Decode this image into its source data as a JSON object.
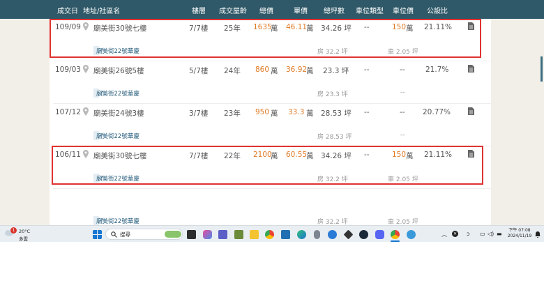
{
  "columns": {
    "date": "成交日",
    "address": "地址/社區名",
    "floor": "樓層",
    "age": "成交屋齡",
    "total": "總價",
    "unit_price": "單價",
    "total_ping": "總坪數",
    "parking_type": "車位類型",
    "parking_price": "車位價",
    "public_ratio": "公設比"
  },
  "rows": [
    {
      "date": "109/09",
      "address": "廟美街30號七樓",
      "floor": "7/7樓",
      "age": "25年",
      "total": "1635",
      "total_unit": "萬",
      "unit_price": "46.11",
      "unit_price_unit": "萬",
      "total_ping": "34.26 坪",
      "parking_type": "--",
      "parking_price": "150",
      "parking_price_unit": "萬",
      "public_ratio": "21.11%",
      "community": "廟美街22號華廈",
      "house_ping": "房 32.2 坪",
      "car_ping": "車 2.05 坪",
      "highlighted": true
    },
    {
      "date": "109/03",
      "address": "廟美街26號5樓",
      "floor": "5/7樓",
      "age": "24年",
      "total": "860",
      "total_unit": "萬",
      "unit_price": "36.92",
      "unit_price_unit": "萬",
      "total_ping": "23.3 坪",
      "parking_type": "--",
      "parking_price": "--",
      "parking_price_unit": "",
      "public_ratio": "21.7%",
      "community": "廟美街22號華廈",
      "house_ping": "房 23.3 坪",
      "car_ping": "--",
      "highlighted": false
    },
    {
      "date": "107/12",
      "address": "廟美街24號3樓",
      "floor": "3/7樓",
      "age": "23年",
      "total": "950",
      "total_unit": "萬",
      "unit_price": "33.3",
      "unit_price_unit": "萬",
      "total_ping": "28.53 坪",
      "parking_type": "--",
      "parking_price": "--",
      "parking_price_unit": "",
      "public_ratio": "20.77%",
      "community": "廟美街22號華廈",
      "house_ping": "房 28.53 坪",
      "car_ping": "--",
      "highlighted": false
    },
    {
      "date": "106/11",
      "address": "廟美街30號七樓",
      "floor": "7/7樓",
      "age": "22年",
      "total": "2100",
      "total_unit": "萬",
      "unit_price": "60.55",
      "unit_price_unit": "萬",
      "total_ping": "34.26 坪",
      "parking_type": "--",
      "parking_price": "150",
      "parking_price_unit": "萬",
      "public_ratio": "21.11%",
      "community": "廟美街22號華廈",
      "house_ping": "房 32.2 坪",
      "car_ping": "車 2.05 坪",
      "highlighted": true
    }
  ],
  "partial_row": {
    "community": "廟美街22號華廈",
    "house_ping": "房 32.2 坪",
    "car_ping": "車 2.05 坪"
  },
  "colors": {
    "header_bg": "#2f5968",
    "orange": "#e07a24",
    "highlight_border": "#e03232",
    "tag_bg": "#e2ecf2"
  },
  "taskbar": {
    "weather_temp": "20°C",
    "weather_desc": "多雲",
    "weather_badge": "1",
    "search_placeholder": "搜尋",
    "time": "下午 07:08",
    "date": "2024/11/19",
    "icons": [
      "start-icon",
      "search-icon",
      "task-view-icon",
      "copilot-icon",
      "teams-icon",
      "minecraft-icon",
      "file-explorer-icon",
      "chrome-icon",
      "store-icon",
      "edge-icon",
      "mouse-app-icon",
      "link-app-icon",
      "obsidian-icon",
      "steam-icon",
      "discord-icon",
      "chrome-active-icon",
      "globe-app-icon"
    ],
    "tray_icons": [
      "chevron-up-icon",
      "close-circle-icon",
      "pen-icon",
      "display-icon",
      "volume-icon",
      "battery-icon",
      "bell-icon"
    ]
  }
}
